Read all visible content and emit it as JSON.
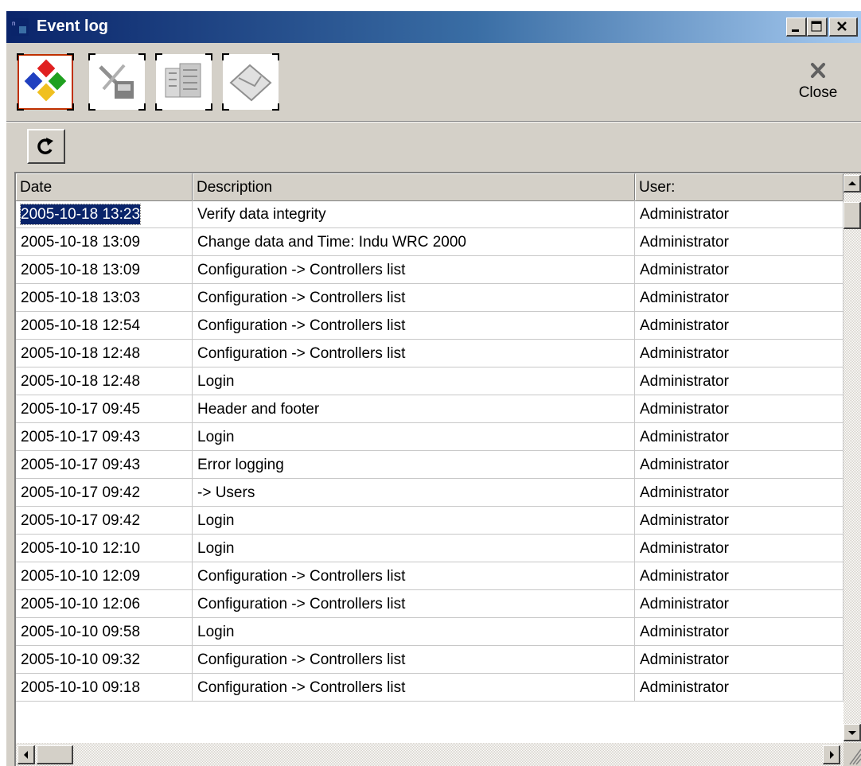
{
  "window": {
    "title": "Event log"
  },
  "titlebar_buttons": {
    "minimize": "_",
    "maximize": "□",
    "close": "×"
  },
  "toolbar": {
    "tools": [
      {
        "name": "modules-tool-icon",
        "active": true
      },
      {
        "name": "settings-tool-icon",
        "active": false
      },
      {
        "name": "buildings-tool-icon",
        "active": false
      },
      {
        "name": "envelope-tool-icon",
        "active": false
      }
    ],
    "close_label": "Close"
  },
  "grid": {
    "columns": [
      "Date",
      "Description",
      "User:"
    ],
    "rows": [
      [
        "2005-10-18 13:23",
        "Verify data integrity",
        "Administrator"
      ],
      [
        "2005-10-18 13:09",
        "Change data and Time: Indu WRC 2000",
        "Administrator"
      ],
      [
        "2005-10-18 13:09",
        "Configuration -> Controllers list",
        "Administrator"
      ],
      [
        "2005-10-18 13:03",
        "Configuration -> Controllers list",
        "Administrator"
      ],
      [
        "2005-10-18 12:54",
        "Configuration -> Controllers list",
        "Administrator"
      ],
      [
        "2005-10-18 12:48",
        "Configuration -> Controllers list",
        "Administrator"
      ],
      [
        "2005-10-18 12:48",
        "Login",
        "Administrator"
      ],
      [
        "2005-10-17 09:45",
        "Header and footer",
        "Administrator"
      ],
      [
        "2005-10-17 09:43",
        "Login",
        "Administrator"
      ],
      [
        "2005-10-17 09:43",
        "Error logging",
        "Administrator"
      ],
      [
        "2005-10-17 09:42",
        " -> Users",
        "Administrator"
      ],
      [
        "2005-10-17 09:42",
        "Login",
        "Administrator"
      ],
      [
        "2005-10-10 12:10",
        "Login",
        "Administrator"
      ],
      [
        "2005-10-10 12:09",
        "Configuration -> Controllers list",
        "Administrator"
      ],
      [
        "2005-10-10 12:06",
        "Configuration -> Controllers list",
        "Administrator"
      ],
      [
        "2005-10-10 09:58",
        "Login",
        "Administrator"
      ],
      [
        "2005-10-10 09:32",
        "Configuration -> Controllers list",
        "Administrator"
      ],
      [
        "2005-10-10 09:18",
        "Configuration -> Controllers list",
        "Administrator"
      ]
    ],
    "selected_row": 0
  },
  "colors": {
    "title_start": "#0a246a",
    "title_end": "#a6caf0",
    "selection": "#0a246a",
    "face": "#d4d0c8"
  }
}
